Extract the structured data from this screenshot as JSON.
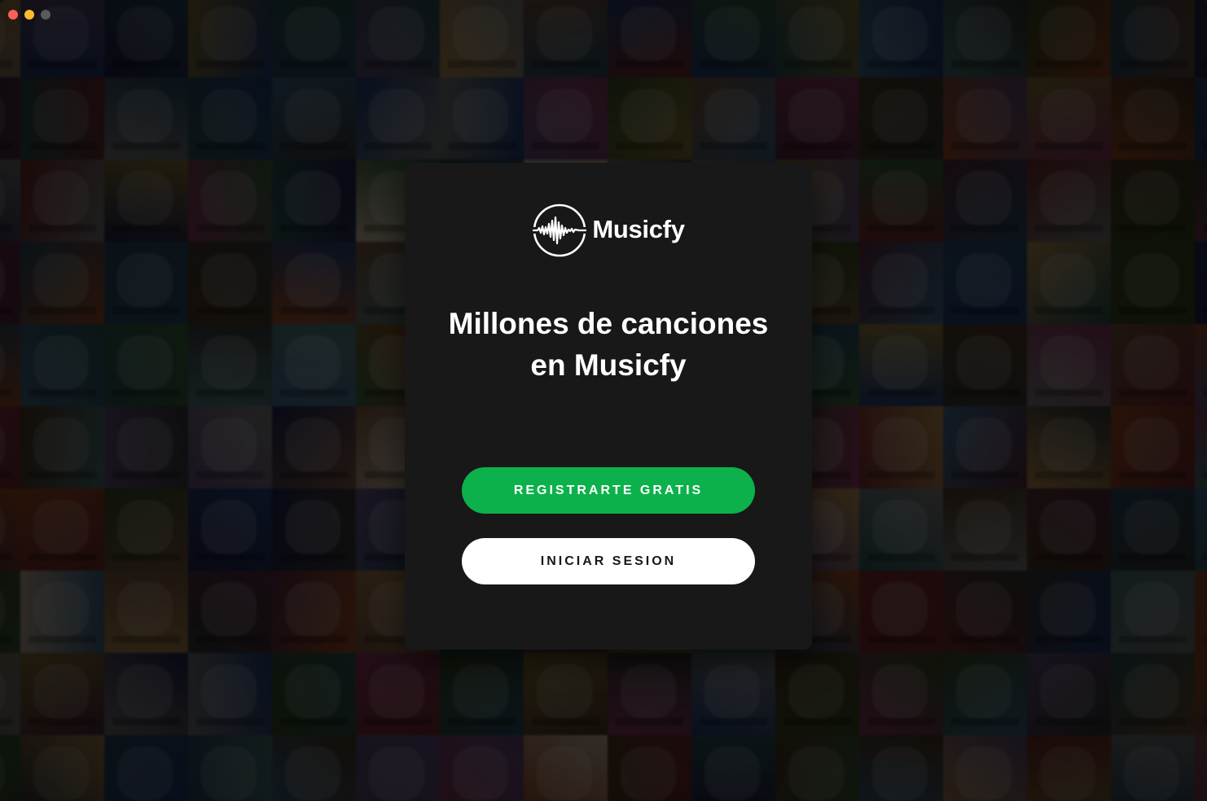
{
  "window": {
    "controls": [
      "close",
      "minimize",
      "maximize"
    ]
  },
  "brand": {
    "name": "Musicfy",
    "logo_icon": "soundwave-circle-icon"
  },
  "headline": "Millones de canciones en Musicfy",
  "buttons": {
    "register_label": "REGISTRARTE GRATIS",
    "login_label": "INICIAR SESION"
  },
  "colors": {
    "accent": "#0db14b",
    "card": "#181818",
    "secondary_button": "#ffffff"
  }
}
